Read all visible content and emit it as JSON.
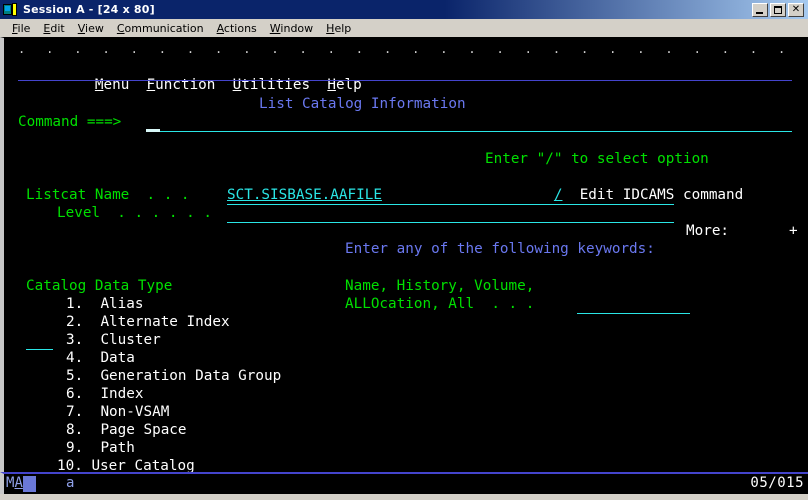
{
  "window": {
    "title": "Session A - [24 x 80]",
    "icon": "terminal-session-icon",
    "minimize_label": "",
    "maximize_label": "",
    "close_label": "✕"
  },
  "menubar": {
    "items": [
      {
        "label": "File",
        "mnemonic": "F"
      },
      {
        "label": "Edit",
        "mnemonic": "E"
      },
      {
        "label": "View",
        "mnemonic": "V"
      },
      {
        "label": "Communication",
        "mnemonic": "C"
      },
      {
        "label": "Actions",
        "mnemonic": "A"
      },
      {
        "label": "Window",
        "mnemonic": "W"
      },
      {
        "label": "Help",
        "mnemonic": "H"
      }
    ]
  },
  "terminal": {
    "ruler": ". . . . . . . . . . . . . . . . . . . . . . . . . . . . . . . . . . . . . .",
    "action_bar": {
      "menu": "Menu",
      "function": "Function",
      "utilities": "Utilities",
      "help": "Help"
    },
    "panel_title": "List Catalog Information",
    "command_label": "Command ===>",
    "command_value": "",
    "select_hint": "Enter \"/\" to select option",
    "option_mark": "/",
    "option_label": "Edit IDCAMS command",
    "listcat_name_label": "Listcat Name  . . .",
    "listcat_name_value": "SCT.SISBASE.AAFILE",
    "level_label": "Level  . . . . . .",
    "level_value": "",
    "more_label": "More:",
    "more_indicator": "+",
    "keywords_heading": "Enter any of the following keywords:",
    "keywords_line1": "Name, History, Volume,",
    "keywords_line2": "ALLOcation, All  . . .",
    "keywords_value": "",
    "catalog_type_heading": "Catalog Data Type",
    "catalog_type_value": "",
    "catalog_types": [
      {
        "num": "1.",
        "label": "Alias"
      },
      {
        "num": "2.",
        "label": "Alternate Index"
      },
      {
        "num": "3.",
        "label": "Cluster"
      },
      {
        "num": "4.",
        "label": "Data"
      },
      {
        "num": "5.",
        "label": "Generation Data Group"
      },
      {
        "num": "6.",
        "label": "Index"
      },
      {
        "num": "7.",
        "label": "Non-VSAM"
      },
      {
        "num": "8.",
        "label": "Page Space"
      },
      {
        "num": "9.",
        "label": "Path"
      },
      {
        "num": "10.",
        "label": "User Catalog"
      }
    ]
  },
  "status": {
    "indicator": "MA",
    "input_mode": "a",
    "cursor_position": "05/015"
  },
  "colors": {
    "titlebar_start": "#0a246a",
    "titlebar_end": "#a6caf0",
    "terminal_bg": "#000000",
    "green": "#00e000",
    "white": "#ffffff",
    "blue": "#6a78f0",
    "cyan": "#2ae6e6",
    "rule_blue": "#4444cc",
    "chrome": "#d4d0c8"
  }
}
